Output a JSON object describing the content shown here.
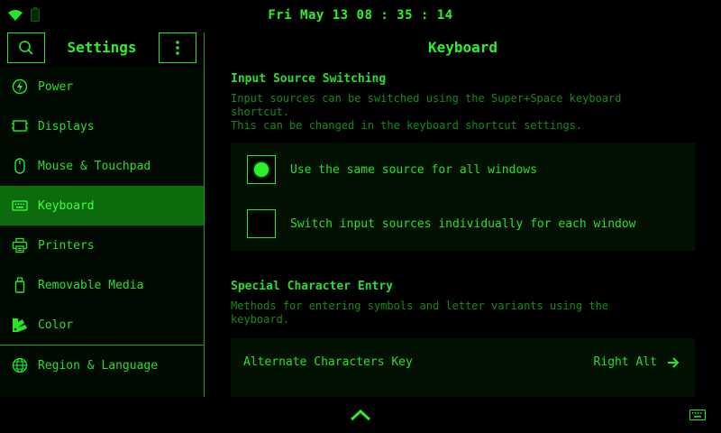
{
  "theme": {
    "accent": "#27e627",
    "accent_bright": "#2cf02c",
    "active_bg": "#0c6b0c",
    "text_dim": "#148c14",
    "panel_bg": "#021102"
  },
  "status": {
    "clock": "Fri May 13 08 : 35 : 14",
    "icons": [
      "wifi-icon",
      "battery-icon"
    ]
  },
  "sidebar": {
    "title": "Settings",
    "items": [
      {
        "label": "Power",
        "icon": "power-icon"
      },
      {
        "label": "Displays",
        "icon": "display-icon"
      },
      {
        "label": "Mouse & Touchpad",
        "icon": "mouse-icon"
      },
      {
        "label": "Keyboard",
        "icon": "keyboard-icon",
        "active": true
      },
      {
        "label": "Printers",
        "icon": "printer-icon"
      },
      {
        "label": "Removable Media",
        "icon": "usb-icon"
      },
      {
        "label": "Color",
        "icon": "color-icon"
      },
      {
        "label": "Region & Language",
        "icon": "globe-icon"
      }
    ]
  },
  "content": {
    "title": "Keyboard",
    "input_source": {
      "title": "Input Source Switching",
      "desc_line1": "Input sources can be switched using the Super+Space keyboard",
      "desc_line2": "shortcut.",
      "desc_line3": "This can be changed in the keyboard shortcut settings.",
      "options": [
        {
          "label": "Use the same source for all windows",
          "selected": true
        },
        {
          "label": "Switch input sources individually for each window",
          "selected": false
        }
      ]
    },
    "special_chars": {
      "title": "Special Character Entry",
      "desc_line1": "Methods for entering symbols and letter variants using the",
      "desc_line2": "keyboard.",
      "alt_key_label": "Alternate Characters Key",
      "alt_key_value": "Right Alt"
    }
  }
}
